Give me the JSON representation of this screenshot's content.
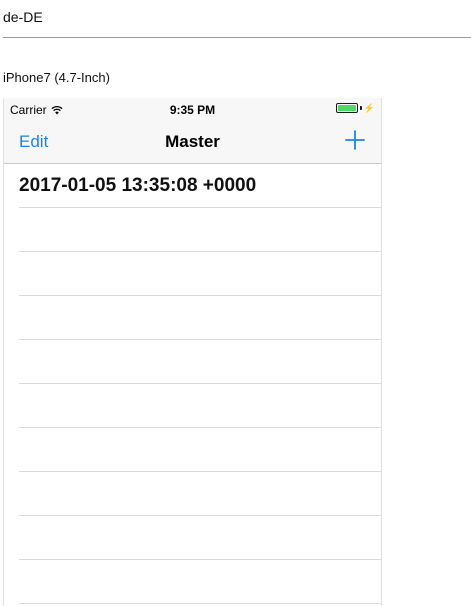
{
  "header": {
    "locale": "de-DE"
  },
  "device": {
    "label": "iPhone7 (4.7-Inch)"
  },
  "status_bar": {
    "carrier": "Carrier",
    "time": "9:35 PM",
    "battery_level": 1.0,
    "charging": true,
    "battery_color": "#4cd964"
  },
  "nav_bar": {
    "edit_label": "Edit",
    "title": "Master",
    "add_icon": "plus-icon",
    "accent_color": "#1a84e6"
  },
  "table": {
    "rows": [
      {
        "text": "2017-01-05 13:35:08 +0000"
      },
      {
        "text": ""
      },
      {
        "text": ""
      },
      {
        "text": ""
      },
      {
        "text": ""
      },
      {
        "text": ""
      },
      {
        "text": ""
      },
      {
        "text": ""
      },
      {
        "text": ""
      },
      {
        "text": ""
      }
    ]
  }
}
